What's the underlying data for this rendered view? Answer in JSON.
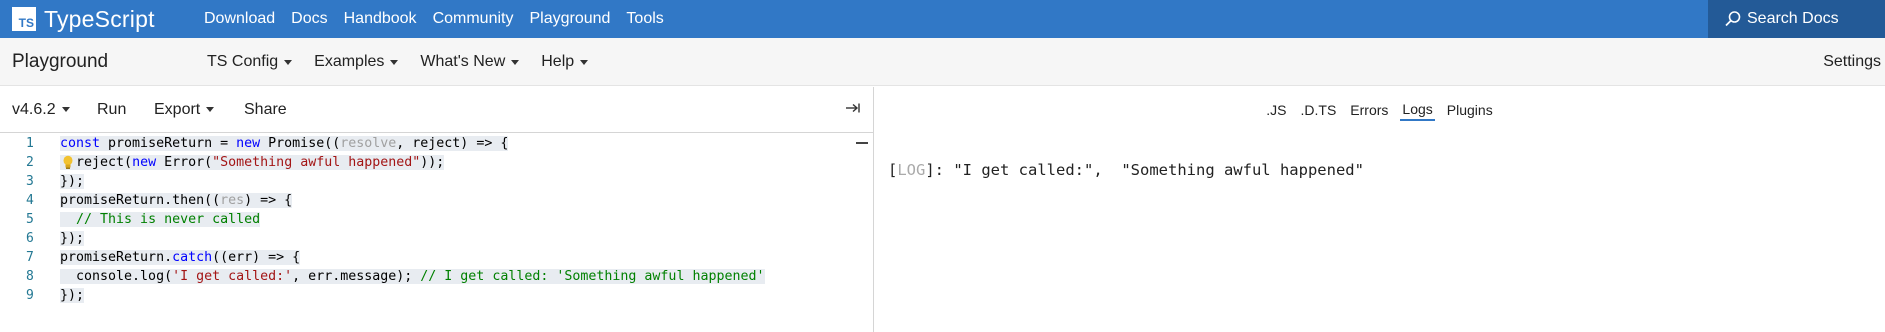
{
  "topnav": {
    "logo_text": "TS",
    "brand": "TypeScript",
    "links": [
      "Download",
      "Docs",
      "Handbook",
      "Community",
      "Playground",
      "Tools"
    ],
    "search_label": "Search Docs",
    "color": "#3178c6",
    "search_bg": "#235a97"
  },
  "playground_nav": {
    "title": "Playground",
    "menus": [
      "TS Config",
      "Examples",
      "What's New",
      "Help"
    ],
    "settings": "Settings"
  },
  "editor_toolbar": {
    "version": "v4.6.2",
    "run": "Run",
    "export": "Export",
    "share": "Share"
  },
  "editor": {
    "line_numbers": [
      "1",
      "2",
      "3",
      "4",
      "5",
      "6",
      "7",
      "8",
      "9"
    ],
    "lines": [
      "const promiseReturn = new Promise((resolve, reject) => {",
      "  reject(new Error(\"Something awful happened\"));",
      "});",
      "promiseReturn.then((res) => {",
      "  // This is never called",
      "});",
      "promiseReturn.catch((err) => {",
      "  console.log('I get called:', err.message); // I get called: 'Something awful happened'",
      "});"
    ]
  },
  "sidebar": {
    "tabs": [
      ".JS",
      ".D.TS",
      "Errors",
      "Logs",
      "Plugins"
    ],
    "active_tab": "Logs",
    "log_prefix_open": "[",
    "log_level": "LOG",
    "log_prefix_close": "]: ",
    "log_arg1": "\"I get called:\",",
    "log_arg2": "\"Something awful happened\""
  }
}
